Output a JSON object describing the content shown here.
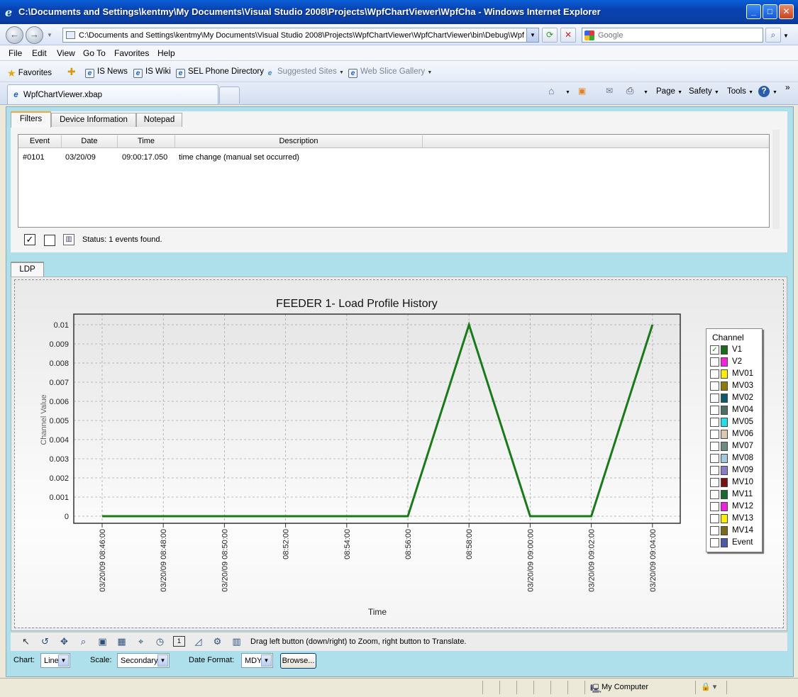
{
  "window": {
    "title": "C:\\Documents and Settings\\kentmy\\My Documents\\Visual Studio 2008\\Projects\\WpfChartViewer\\WpfCha - Windows Internet Explorer"
  },
  "nav": {
    "address": "C:\\Documents and Settings\\kentmy\\My Documents\\Visual Studio 2008\\Projects\\WpfChartViewer\\WpfChartViewer\\bin\\Debug\\WpfCl",
    "search_placeholder": "Google"
  },
  "menu": [
    "File",
    "Edit",
    "View",
    "Go To",
    "Favorites",
    "Help"
  ],
  "favorites": {
    "label": "Favorites",
    "items": [
      "IS News",
      "IS Wiki",
      "SEL Phone Directory",
      "Suggested Sites",
      "Web Slice Gallery"
    ]
  },
  "tab": {
    "title": "WpfChartViewer.xbap"
  },
  "commands": [
    "Page",
    "Safety",
    "Tools"
  ],
  "filters": {
    "tabs": [
      "Filters",
      "Device Information",
      "Notepad"
    ],
    "columns": [
      "Event",
      "Date",
      "Time",
      "Description"
    ],
    "rows": [
      {
        "event": "#0101",
        "date": "03/20/09",
        "time": "09:00:17.050",
        "description": "time change (manual set occurred)"
      }
    ],
    "status": "Status: 1 events found."
  },
  "ldp_tab": "LDP",
  "chart_data": {
    "type": "line",
    "title": "FEEDER 1- Load Profile History",
    "xlabel": "Time",
    "ylabel": "Channel Value",
    "ylim": [
      0,
      0.01
    ],
    "yticks": [
      "0",
      "0.001",
      "0.002",
      "0.003",
      "0.004",
      "0.005",
      "0.006",
      "0.007",
      "0.008",
      "0.009",
      "0.01"
    ],
    "xticks": [
      "03/20/09 08:46:00",
      "03/20/09 08:48:00",
      "03/20/09 08:50:00",
      "08:52:00",
      "08:54:00",
      "08:56:00",
      "08:58:00",
      "03/20/09 09:00:00",
      "03/20/09 09:02:00",
      "03/20/09 09:04:00"
    ],
    "grid": true,
    "legend_title": "Channel",
    "series": [
      {
        "name": "V1",
        "color": "#1a7a1a",
        "x": [
          "08:46:00",
          "08:56:00",
          "08:58:00",
          "09:00:00",
          "09:02:00",
          "09:04:00"
        ],
        "y": [
          0,
          0,
          0.01,
          0,
          0,
          0.01
        ]
      }
    ],
    "legend": [
      {
        "name": "V1",
        "color": "#1a6b1a",
        "checked": true
      },
      {
        "name": "V2",
        "color": "#ff22dd",
        "checked": false
      },
      {
        "name": "MV01",
        "color": "#ffee00",
        "checked": false
      },
      {
        "name": "MV03",
        "color": "#8a7a10",
        "checked": false
      },
      {
        "name": "MV02",
        "color": "#0d5a6a",
        "checked": false
      },
      {
        "name": "MV04",
        "color": "#4f6e66",
        "checked": false
      },
      {
        "name": "MV05",
        "color": "#22ddee",
        "checked": false
      },
      {
        "name": "MV06",
        "color": "#d9c9b0",
        "checked": false
      },
      {
        "name": "MV07",
        "color": "#6f8a80",
        "checked": false
      },
      {
        "name": "MV08",
        "color": "#9fc9de",
        "checked": false
      },
      {
        "name": "MV09",
        "color": "#8a7acc",
        "checked": false
      },
      {
        "name": "MV10",
        "color": "#7a1010",
        "checked": false
      },
      {
        "name": "MV11",
        "color": "#166a2a",
        "checked": false
      },
      {
        "name": "MV12",
        "color": "#ee22dd",
        "checked": false
      },
      {
        "name": "MV13",
        "color": "#ffee00",
        "checked": false
      },
      {
        "name": "MV14",
        "color": "#7a6a1a",
        "checked": false
      },
      {
        "name": "Event",
        "color": "#4a5aa8",
        "checked": false
      }
    ]
  },
  "chart_tools": {
    "hint": "Drag left button (down/right) to Zoom, right button to Translate."
  },
  "bottom": {
    "chart_label": "Chart:",
    "chart_value": "Line",
    "scale_label": "Scale:",
    "scale_value": "Secondary",
    "date_label": "Date Format:",
    "date_value": "MDY",
    "browse": "Browse..."
  },
  "statusbar": {
    "zone": "My Computer"
  }
}
